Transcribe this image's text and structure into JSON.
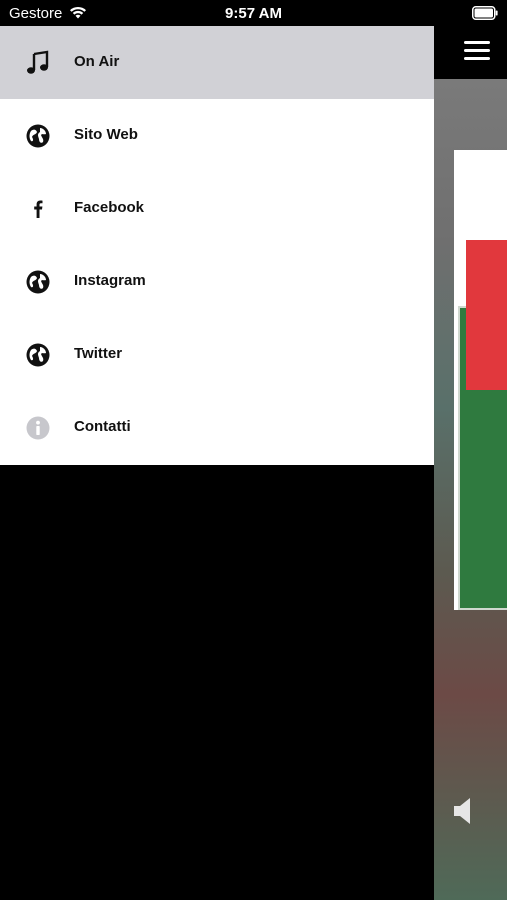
{
  "status_bar": {
    "carrier": "Gestore",
    "time": "9:57 AM"
  },
  "drawer": {
    "items": [
      {
        "label": "On Air",
        "icon": "music-note-icon",
        "active": true
      },
      {
        "label": "Sito Web",
        "icon": "globe-icon",
        "active": false
      },
      {
        "label": "Facebook",
        "icon": "facebook-icon",
        "active": false
      },
      {
        "label": "Instagram",
        "icon": "globe-icon",
        "active": false
      },
      {
        "label": "Twitter",
        "icon": "globe-icon",
        "active": false
      },
      {
        "label": "Contatti",
        "icon": "info-icon",
        "active": false
      }
    ]
  },
  "colors": {
    "drawer_background": "#ffffff",
    "active_item_background": "#d1d1d6",
    "screen_background": "#000000"
  }
}
